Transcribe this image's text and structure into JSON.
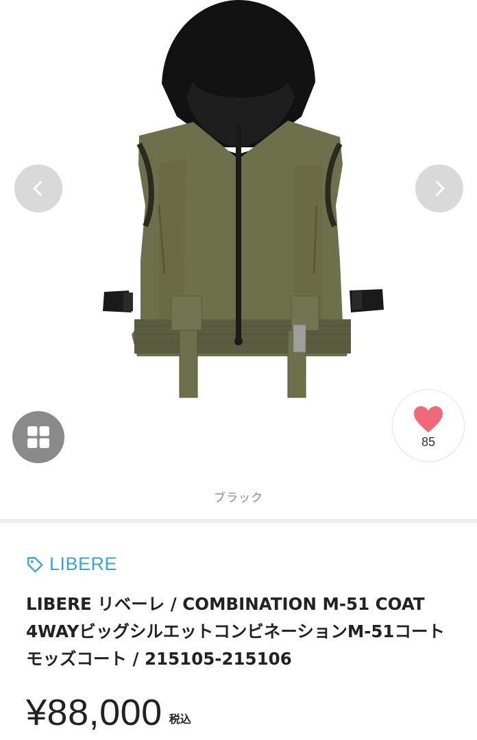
{
  "gallery": {
    "image_alt": "vest-with-hood",
    "prev_icon": "chevron-left-icon",
    "next_icon": "chevron-right-icon",
    "grid_icon": "grid-icon",
    "like_icon": "heart-icon",
    "like_count": "85",
    "color_label": "ブラック"
  },
  "product": {
    "brand_icon": "tag-icon",
    "brand": "LIBERE",
    "title": "LIBERE リベーレ / COMBINATION M-51 COAT 4WAYビッグシルエットコンビネーションM-51コート モッズコート / 215105-215106",
    "price": "¥88,000",
    "tax_label": "税込"
  },
  "colors": {
    "brand_accent": "#3aa5cf",
    "heart": "#f0687a",
    "nav_button_bg": "#d9d9d9",
    "grid_button_bg": "#8a8a8a"
  }
}
